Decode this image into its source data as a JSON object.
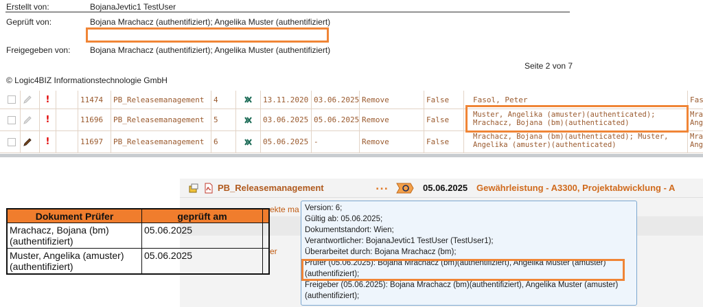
{
  "doc_meta": {
    "created_by_label": "Erstellt von:",
    "created_by_value": "BojanaJevtic1 TestUser",
    "reviewed_by_label": "Geprüft von:",
    "reviewed_by_value": "Bojana Mrachacz (authentifiziert); Angelika Muster (authentifiziert)",
    "released_by_label": "Freigegeben von:",
    "released_by_value": "Bojana Mrachacz (authentifiziert); Angelika Muster (authentifiziert)",
    "page_indicator": "Seite 2 von 7",
    "copyright": "© Logic4BIZ Informationstechnologie GmbH"
  },
  "grid": {
    "rows": [
      {
        "priority": "!",
        "id": "11474",
        "name": "PB_Releasemanagement",
        "version": "4",
        "date1": "13.11.2020",
        "date2": "03.06.2025",
        "action": "Remove",
        "flag": "False",
        "persons": "Fasol, Peter",
        "overflow": "Faso"
      },
      {
        "priority": "!",
        "id": "11696",
        "name": "PB_Releasemanagement",
        "version": "5",
        "date1": "03.06.2025",
        "date2": "05.06.2025",
        "action": "Remove",
        "flag": "False",
        "persons": "Muster, Angelika (amuster)(authenticated); Mrachacz, Bojana (bm)(authenticated)",
        "overflow": "Mra Ang"
      },
      {
        "priority": "!",
        "id": "11697",
        "name": "PB_Releasemanagement",
        "version": "6",
        "date1": "05.06.2025",
        "date2": "-",
        "action": "Remove",
        "flag": "False",
        "persons": "Mrachacz, Bojana (bm)(authenticated); Muster, Angelika (amuster)(authenticated)",
        "overflow": "Mra Ang"
      }
    ]
  },
  "panel": {
    "doc_link": "PB_Releasemanagement",
    "dots": "...",
    "date": "05.06.2025",
    "tags": "Gewährleistung - A3300, Projektabwicklung - A",
    "partial_text_1": "ekte ma",
    "partial_text_2": "er"
  },
  "pruefer_table": {
    "headers": [
      "Dokument Prüfer",
      "geprüft am"
    ],
    "rows": [
      {
        "name": "Mrachacz, Bojana (bm) (authentifiziert)",
        "date": "05.06.2025"
      },
      {
        "name": "Muster, Angelika (amuster) (authentifiziert)",
        "date": "05.06.2025"
      }
    ]
  },
  "tooltip": {
    "lines": [
      "Version: 6;",
      "Gültig ab: 05.06.2025;",
      "Dokumentstandort: Wien;",
      "Verantwortlicher: BojanaJevtic1 TestUser (TestUser1);",
      "Überarbeitet durch: Bojana Mrachacz (bm);",
      "Prüfer (05.06.2025): Bojana Mrachacz (bm)(authentifiziert), Angelika Muster (amuster)",
      "(authentifiziert);",
      "Freigeber (05.06.2025): Bojana Mrachacz (bm)(authentifiziert), Angelika Muster (amuster)",
      "(authentifiziert);"
    ]
  },
  "colors": {
    "highlight": "#f08536",
    "link_brown": "#9a5a2e",
    "tag_orange": "#d06a1c"
  }
}
